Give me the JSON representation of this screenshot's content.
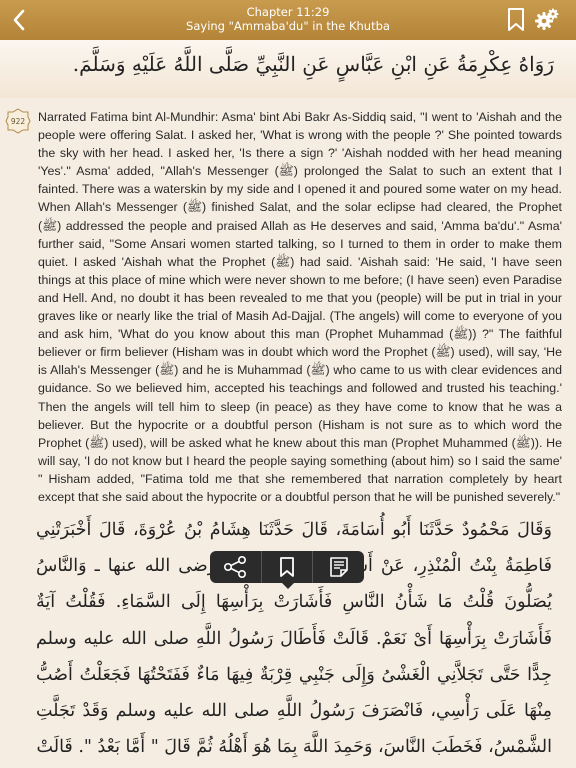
{
  "header": {
    "chapter": "Chapter 11:29",
    "title": "Saying \"Ammaba'du\" in the Khutba",
    "back_icon": "chevron-left-icon",
    "bookmark_icon": "bookmark-icon",
    "settings_icon": "gear-icon"
  },
  "arabic_header": "رَوَاهُ عِكْرِمَةُ عَنِ ابْنِ عَبَّاسٍ عَنِ النَّبِيِّ صَلَّى اللَّهُ عَلَيْهِ وَسَلَّمَ.",
  "hadith": {
    "number": "922",
    "english": "Narrated Fatima bint Al-Mundhir: Asma' bint Abi Bakr As-Siddiq said, \"I went to 'Aishah and the people were offering Salat. I asked her, 'What is wrong with the people ?' She pointed towards the sky with her head. I asked her, 'Is there a sign ?' 'Aishah nodded with her head meaning 'Yes'.\" Asma' added, \"Allah's Messenger (ﷺ) prolonged the Salat to such an extent that I fainted. There was a waterskin by my side and I opened it and poured some water on my head. When Allah's Messenger (ﷺ) finished Salat, and the solar eclipse had cleared, the Prophet (ﷺ) addressed the people and praised Allah as He deserves and said, 'Amma ba'du'.\" Asma' further said, \"Some Ansari women started talking, so I turned to them in order to make them quiet. I asked 'Aishah what the Prophet (ﷺ) had said. 'Aishah said: 'He said, 'I have seen things at this place of mine which were never shown to me before; (I have seen) even Paradise and Hell. And, no doubt it has been revealed to me that you (people) will be put in trial in your graves like or nearly like the trial of Masih Ad-Dajjal. (The angels) will come to everyone of you and ask him, 'What do you know about this man (Prophet Muhammad (ﷺ)) ?\" The faithful believer or firm believer (Hisham was in doubt which word the Prophet (ﷺ) used), will say, 'He is Allah's Messenger (ﷺ) and he is Muhammad (ﷺ) who came to us with clear evidences and guidance. So we believed him, accepted his teachings and followed and trusted his teaching.' Then the angels will tell him to sleep (in peace) as they have come to know that he was a believer. But the hypocrite or a doubtful person (Hisham is not sure as to which word the Prophet (ﷺ) used), will be asked what he knew about this man (Prophet Muhammed (ﷺ)). He will say, 'I do not know but I heard the people saying something (about him) so I said the same' \" Hisham added, \"Fatima told me that she remembered that narration completely by heart except that she said about the hypocrite or a doubtful person that he will be punished severely.\"",
    "arabic": "وَقَالَ مَحْمُودٌ حَدَّثَنَا أَبُو أُسَامَةَ، قَالَ حَدَّثَنَا هِشَامُ بْنُ عُرْوَةَ، قَالَ أَخْبَرَتْنِي فَاطِمَةُ بِنْتُ الْمُنْذِرِ، عَنْ أَسْمَاءَ بِنْتِ أَبِي بَكْرٍ، رضى الله عنها ـ وَالنَّاسُ يُصَلُّونَ قُلْتُ مَا شَأْنُ النَّاسِ فَأَشَارَتْ بِرَأْسِهَا إِلَى السَّمَاءِ. فَقُلْتُ آيَةٌ فَأَشَارَتْ بِرَأْسِهَا أَىْ نَعَمْ. قَالَتْ فَأَطَالَ رَسُولُ اللَّهِ صلى الله عليه وسلم جِدًّا حَتَّى تَجَلاَّنِي الْغَشْىُ وَإِلَى جَنْبِي قِرْبَةٌ فِيهَا مَاءٌ فَفَتَحْتُهَا فَجَعَلْتُ أَصُبُّ مِنْهَا عَلَى رَأْسِي، فَانْصَرَفَ رَسُولُ اللَّهِ صلى الله عليه وسلم وَقَدْ تَجَلَّتِ الشَّمْسُ، فَخَطَبَ النَّاسَ، وَحَمِدَ اللَّهَ بِمَا هُوَ أَهْلُهُ ثُمَّ قَالَ ‏\"‏ أَمَّا بَعْدُ ‏\"‏. قَالَتْ"
  },
  "toolbar": {
    "share_icon": "share-icon",
    "bookmark_icon": "bookmark-icon",
    "note_icon": "note-icon"
  },
  "colors": {
    "topbar": "#b38437",
    "background": "#f6ede2",
    "toolbar": "#2b2b2b"
  }
}
